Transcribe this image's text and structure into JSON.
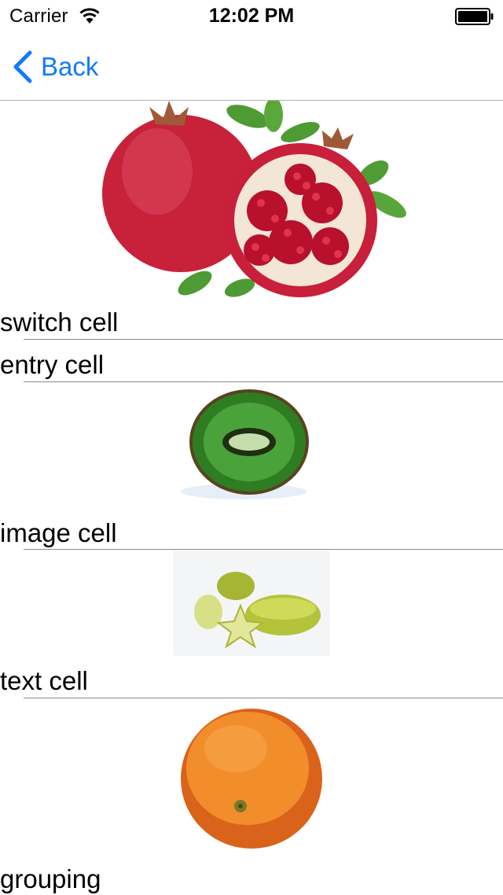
{
  "status_bar": {
    "carrier": "Carrier",
    "time": "12:02 PM",
    "icons": [
      "wifi-icon",
      "battery-icon"
    ]
  },
  "nav": {
    "back_label": "Back",
    "accent_color": "#127afb"
  },
  "cells": [
    {
      "label": "switch cell",
      "image": "pomegranate"
    },
    {
      "label": "entry cell",
      "image": null
    },
    {
      "label": "image cell",
      "image": "kiwi"
    },
    {
      "label": "text cell",
      "image": "star-fruit"
    },
    {
      "label": "grouping",
      "image": "orange"
    }
  ]
}
